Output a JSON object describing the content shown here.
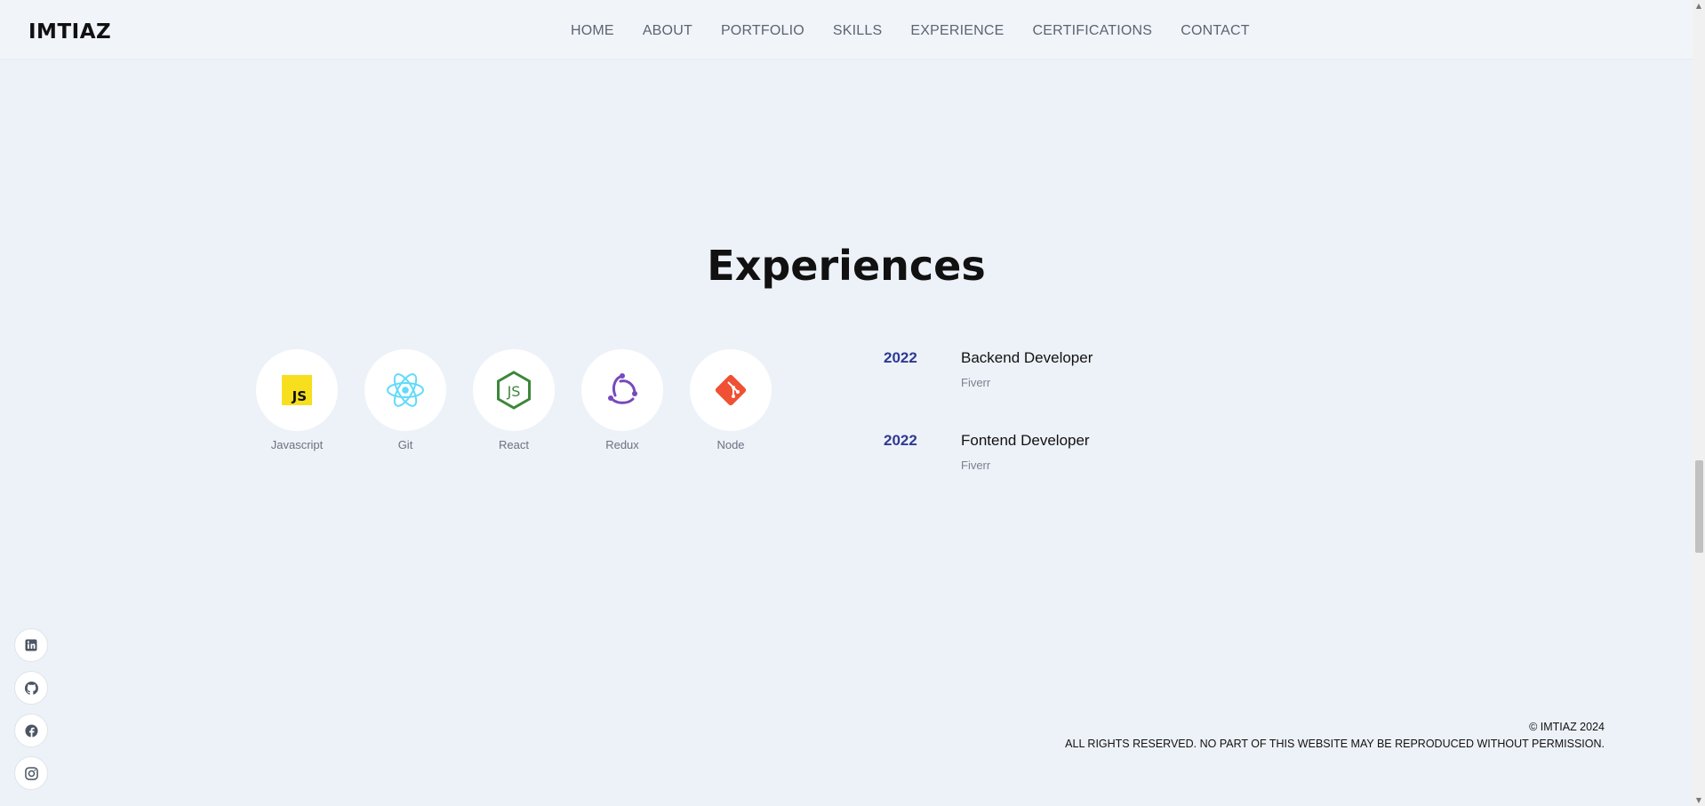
{
  "header": {
    "logo": "IMTIAZ",
    "nav": [
      "HOME",
      "ABOUT",
      "PORTFOLIO",
      "SKILLS",
      "EXPERIENCE",
      "CERTIFICATIONS",
      "CONTACT"
    ]
  },
  "section": {
    "title": "Experiences"
  },
  "skills": [
    {
      "label": "Javascript",
      "icon": "javascript-icon"
    },
    {
      "label": "Git",
      "icon": "react-icon"
    },
    {
      "label": "React",
      "icon": "nodejs-icon"
    },
    {
      "label": "Redux",
      "icon": "redux-icon"
    },
    {
      "label": "Node",
      "icon": "git-icon"
    }
  ],
  "experiences": [
    {
      "year": "2022",
      "title": "Backend Developer",
      "company": "Fiverr"
    },
    {
      "year": "2022",
      "title": "Fontend Developer",
      "company": "Fiverr"
    }
  ],
  "social": [
    "linkedin-icon",
    "github-icon",
    "facebook-icon",
    "instagram-icon"
  ],
  "footer": {
    "copyright": "© IMTIAZ 2024",
    "rights": "ALL RIGHTS RESERVED. NO PART OF THIS WEBSITE MAY BE REPRODUCED WITHOUT PERMISSION."
  },
  "colors": {
    "background": "#edf2f8",
    "year_accent": "#2f3a94",
    "javascript": "#f7df1e",
    "react": "#61dafb",
    "node": "#3c873a",
    "redux": "#764abc",
    "git": "#f05033"
  }
}
